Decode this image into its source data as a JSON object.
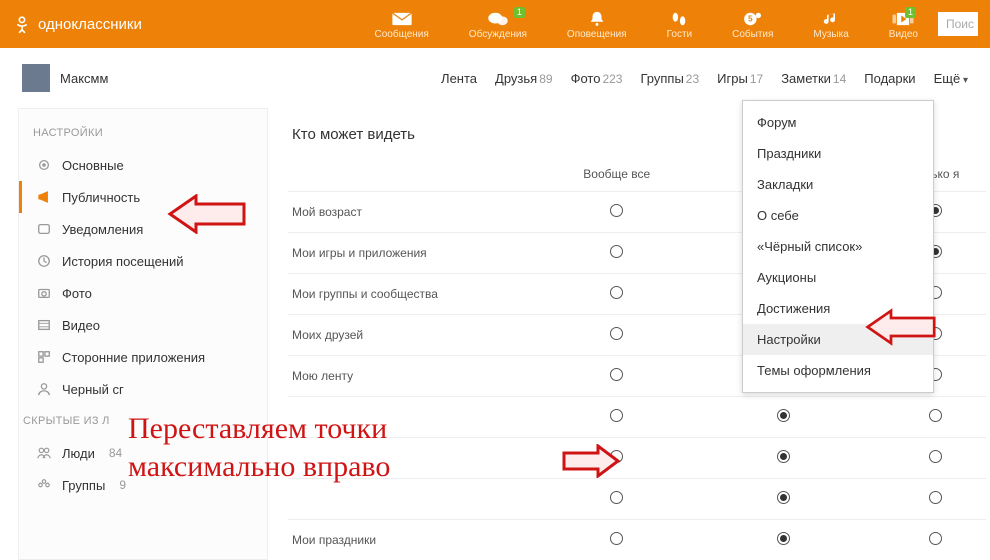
{
  "brand": "одноклассники",
  "topnav": [
    {
      "label": "Сообщения",
      "badge": null
    },
    {
      "label": "Обсуждения",
      "badge": "1"
    },
    {
      "label": "Оповещения",
      "badge": null
    },
    {
      "label": "Гости",
      "badge": null
    },
    {
      "label": "События",
      "badge": null
    },
    {
      "label": "Музыка",
      "badge": null
    },
    {
      "label": "Видео",
      "badge": "1"
    }
  ],
  "search_placeholder": "Поис",
  "user_name": "Максмм",
  "tabs": {
    "lenta": "Лента",
    "friends": "Друзья",
    "friends_cnt": "89",
    "photo": "Фото",
    "photo_cnt": "223",
    "groups": "Группы",
    "groups_cnt": "23",
    "games": "Игры",
    "games_cnt": "17",
    "notes": "Заметки",
    "notes_cnt": "14",
    "gifts": "Подарки",
    "more": "Ещё"
  },
  "side_header": "НАСТРОЙКИ",
  "side_items": [
    "Основные",
    "Публичность",
    "Уведомления",
    "История посещений",
    "Фото",
    "Видео",
    "Сторонние приложения",
    "Черный сг"
  ],
  "side_header2": "СКРЫТЫЕ ИЗ Л",
  "side_items2": {
    "people": "Люди",
    "people_cnt": "84",
    "groups": "Группы",
    "groups_cnt": "9"
  },
  "main_heading": "Кто может видеть",
  "cols": {
    "all": "Вообще все",
    "friends_hidden": "",
    "only_me": "Только я"
  },
  "rows": [
    {
      "label": "Мой возраст",
      "sel": 2
    },
    {
      "label": "Мои игры и приложения",
      "sel": 2
    },
    {
      "label": "Мои группы и сообщества",
      "sel": 1
    },
    {
      "label": "Моих друзей",
      "sel": 1
    },
    {
      "label": "Мою ленту",
      "sel": 1
    },
    {
      "label": "",
      "sel": 1
    },
    {
      "label": "",
      "sel": 1
    },
    {
      "label": "",
      "sel": 1
    },
    {
      "label": "Мои праздники",
      "sel": 1
    }
  ],
  "dropdown": [
    "Форум",
    "Праздники",
    "Закладки",
    "О себе",
    "«Чёрный список»",
    "Аукционы",
    "Достижения",
    "Настройки",
    "Темы оформления"
  ],
  "dropdown_hover_index": 7,
  "annotation_text": "Переставляем точки\nмаксимально вправо"
}
